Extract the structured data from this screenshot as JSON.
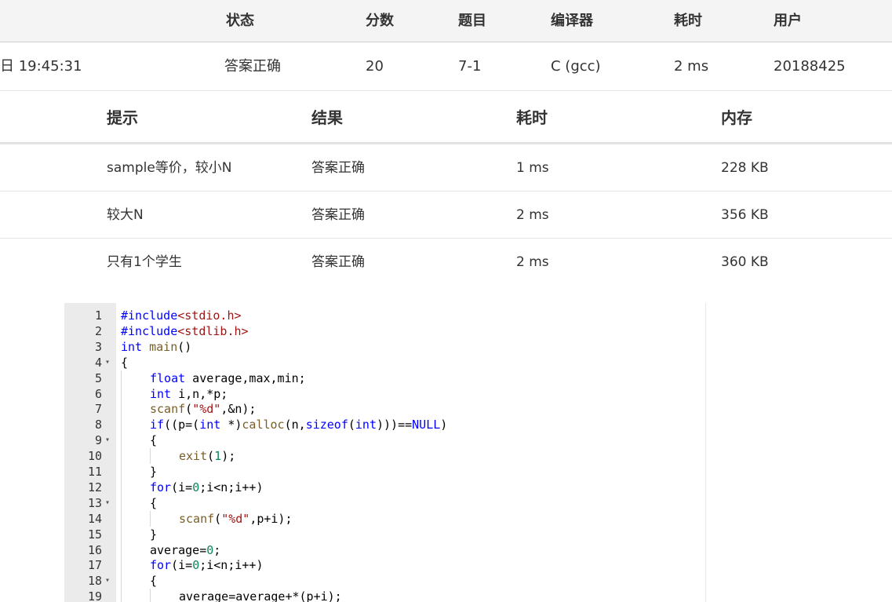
{
  "submission": {
    "headers": [
      "状态",
      "分数",
      "题目",
      "编译器",
      "耗时",
      "用户"
    ],
    "row": {
      "time": "日 19:45:31",
      "status": "答案正确",
      "score": "20",
      "problem": "7-1",
      "compiler": "C (gcc)",
      "elapsed": "2 ms",
      "user": "20188425"
    }
  },
  "cases": {
    "headers": [
      "提示",
      "结果",
      "耗时",
      "内存"
    ],
    "rows": [
      {
        "hint": "sample等价，较小N",
        "result": "答案正确",
        "time": "1 ms",
        "memory": "228 KB"
      },
      {
        "hint": "较大N",
        "result": "答案正确",
        "time": "2 ms",
        "memory": "356 KB"
      },
      {
        "hint": "只有1个学生",
        "result": "答案正确",
        "time": "2 ms",
        "memory": "360 KB"
      }
    ]
  },
  "code": {
    "lines": [
      {
        "n": "1",
        "fold": false,
        "indent": 0,
        "text": "#include<stdio.h>"
      },
      {
        "n": "2",
        "fold": false,
        "indent": 0,
        "text": "#include<stdlib.h>"
      },
      {
        "n": "3",
        "fold": false,
        "indent": 0,
        "text": "int main()"
      },
      {
        "n": "4",
        "fold": true,
        "indent": 0,
        "text": "{"
      },
      {
        "n": "5",
        "fold": false,
        "indent": 1,
        "text": "float average,max,min;"
      },
      {
        "n": "6",
        "fold": false,
        "indent": 1,
        "text": "int i,n,*p;"
      },
      {
        "n": "7",
        "fold": false,
        "indent": 1,
        "text": "scanf(\"%d\",&n);"
      },
      {
        "n": "8",
        "fold": false,
        "indent": 1,
        "text": "if((p=(int *)calloc(n,sizeof(int)))==NULL)"
      },
      {
        "n": "9",
        "fold": true,
        "indent": 1,
        "text": "{"
      },
      {
        "n": "10",
        "fold": false,
        "indent": 2,
        "text": "exit(1);"
      },
      {
        "n": "11",
        "fold": false,
        "indent": 1,
        "text": "}"
      },
      {
        "n": "12",
        "fold": false,
        "indent": 1,
        "text": "for(i=0;i<n;i++)"
      },
      {
        "n": "13",
        "fold": true,
        "indent": 1,
        "text": "{"
      },
      {
        "n": "14",
        "fold": false,
        "indent": 2,
        "text": "scanf(\"%d\",p+i);"
      },
      {
        "n": "15",
        "fold": false,
        "indent": 1,
        "text": "}"
      },
      {
        "n": "16",
        "fold": false,
        "indent": 1,
        "text": "average=0;"
      },
      {
        "n": "17",
        "fold": false,
        "indent": 1,
        "text": "for(i=0;i<n;i++)"
      },
      {
        "n": "18",
        "fold": true,
        "indent": 1,
        "text": "{"
      },
      {
        "n": "19",
        "fold": false,
        "indent": 2,
        "text": "average=average+*(p+i);"
      }
    ]
  },
  "icons": {
    "fold": "fold-arrow-down-icon"
  }
}
